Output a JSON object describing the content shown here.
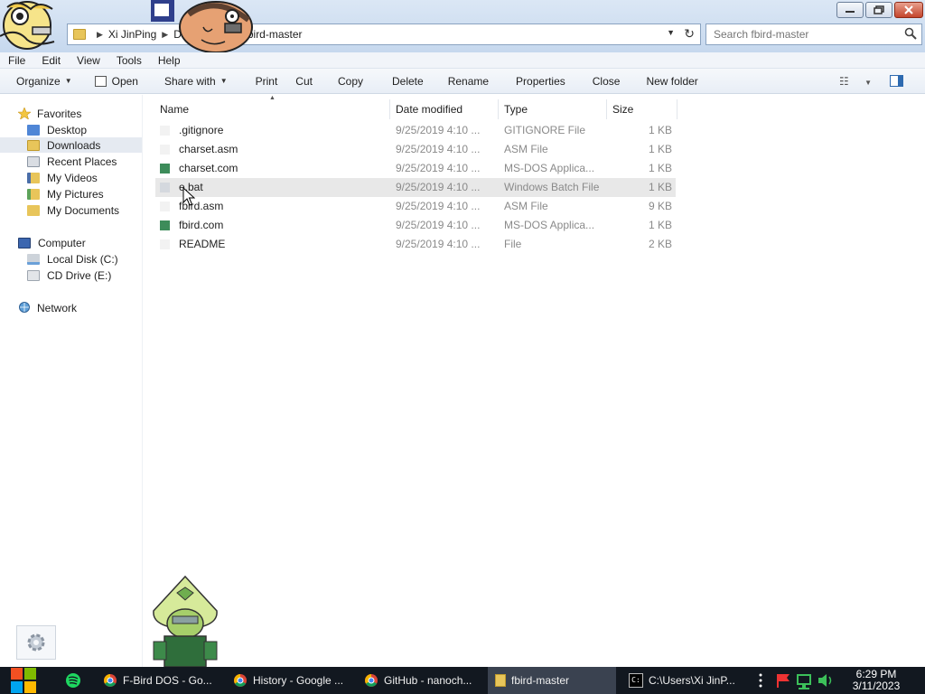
{
  "window": {
    "breadcrumbs": [
      "Xi JinPing",
      "Downloads",
      "fbird-master"
    ],
    "address_tail": "d-master",
    "search_placeholder": "Search fbird-master"
  },
  "menu": {
    "items": [
      "File",
      "Edit",
      "View",
      "Tools",
      "Help"
    ]
  },
  "commandbar": {
    "organize": "Organize",
    "open": "Open",
    "share_with": "Share with",
    "print": "Print",
    "cut": "Cut",
    "copy": "Copy",
    "delete": "Delete",
    "rename": "Rename",
    "properties": "Properties",
    "close": "Close",
    "new_folder": "New folder"
  },
  "nav": {
    "favorites": "Favorites",
    "favorites_items": [
      "Desktop",
      "Downloads",
      "Recent Places",
      "My Videos",
      "My Pictures",
      "My Documents"
    ],
    "computer": "Computer",
    "computer_items": [
      "Local Disk (C:)",
      "CD Drive (E:)"
    ],
    "network": "Network"
  },
  "columns": {
    "name": "Name",
    "date": "Date modified",
    "type": "Type",
    "size": "Size"
  },
  "files": [
    {
      "name": ".gitignore",
      "date": "9/25/2019 4:10 ...",
      "type": "GITIGNORE File",
      "size": "1 KB"
    },
    {
      "name": "charset.asm",
      "date": "9/25/2019 4:10 ...",
      "type": "ASM File",
      "size": "1 KB"
    },
    {
      "name": "charset.com",
      "date": "9/25/2019 4:10 ...",
      "type": "MS-DOS Applica...",
      "size": "1 KB"
    },
    {
      "name": "e.bat",
      "date": "9/25/2019 4:10 ...",
      "type": "Windows Batch File",
      "size": "1 KB"
    },
    {
      "name": "fbird.asm",
      "date": "9/25/2019 4:10 ...",
      "type": "ASM File",
      "size": "9 KB"
    },
    {
      "name": "fbird.com",
      "date": "9/25/2019 4:10 ...",
      "type": "MS-DOS Applica...",
      "size": "1 KB"
    },
    {
      "name": "README",
      "date": "9/25/2019 4:10 ...",
      "type": "File",
      "size": "2 KB"
    }
  ],
  "taskbar": {
    "tasks": [
      "F-Bird DOS - Go...",
      "History - Google ...",
      "GitHub - nanoch...",
      "fbird-master",
      "C:\\Users\\Xi JinP..."
    ],
    "time": "6:29 PM",
    "date": "3/11/2023"
  }
}
